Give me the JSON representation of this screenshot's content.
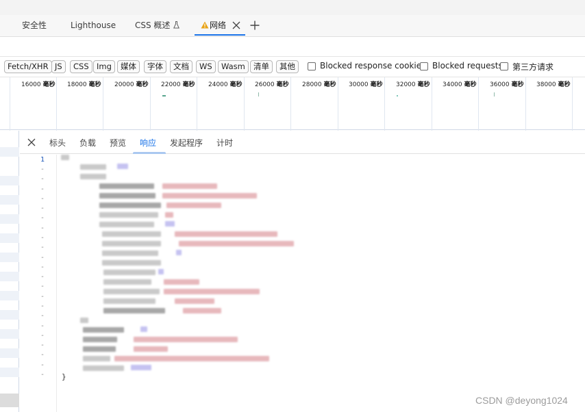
{
  "tabs": [
    {
      "label": "安全性"
    },
    {
      "label": "Lighthouse"
    },
    {
      "label": "CSS 概述"
    },
    {
      "label": "网络",
      "active": true,
      "warning": true
    }
  ],
  "filters": {
    "types": [
      "Fetch/XHR",
      "JS",
      "CSS",
      "Img",
      "媒体",
      "字体",
      "文档",
      "WS",
      "Wasm",
      "清单",
      "其他"
    ],
    "checkboxes": [
      {
        "label": "Blocked response cookies",
        "checked": false
      },
      {
        "label": "Blocked requests",
        "checked": false
      },
      {
        "label": "第三方请求",
        "checked": false
      }
    ]
  },
  "timeline": {
    "unit": "毫秒",
    "ticks": [
      "16000",
      "18000",
      "20000",
      "22000",
      "24000",
      "26000",
      "28000",
      "30000",
      "32000",
      "34000",
      "36000",
      "38000"
    ]
  },
  "detail": {
    "tabs": [
      "标头",
      "负载",
      "预览",
      "响应",
      "发起程序",
      "计时"
    ],
    "active_tab": "响应",
    "line_numbers": [
      "1",
      "-",
      "-",
      "-",
      "-",
      "-",
      "-",
      "-",
      "-",
      "-",
      "-",
      "-",
      "-",
      "-",
      "-",
      "-",
      "-",
      "-",
      "-",
      "-",
      "-",
      "-",
      "-"
    ],
    "closing_brace": "}"
  },
  "watermark": "CSDN @deyong1024",
  "colors": {
    "accent": "#1a73e8",
    "warning": "#e8a317"
  },
  "icons": [
    "warning-icon",
    "flask-icon",
    "close-icon",
    "plus-icon"
  ]
}
